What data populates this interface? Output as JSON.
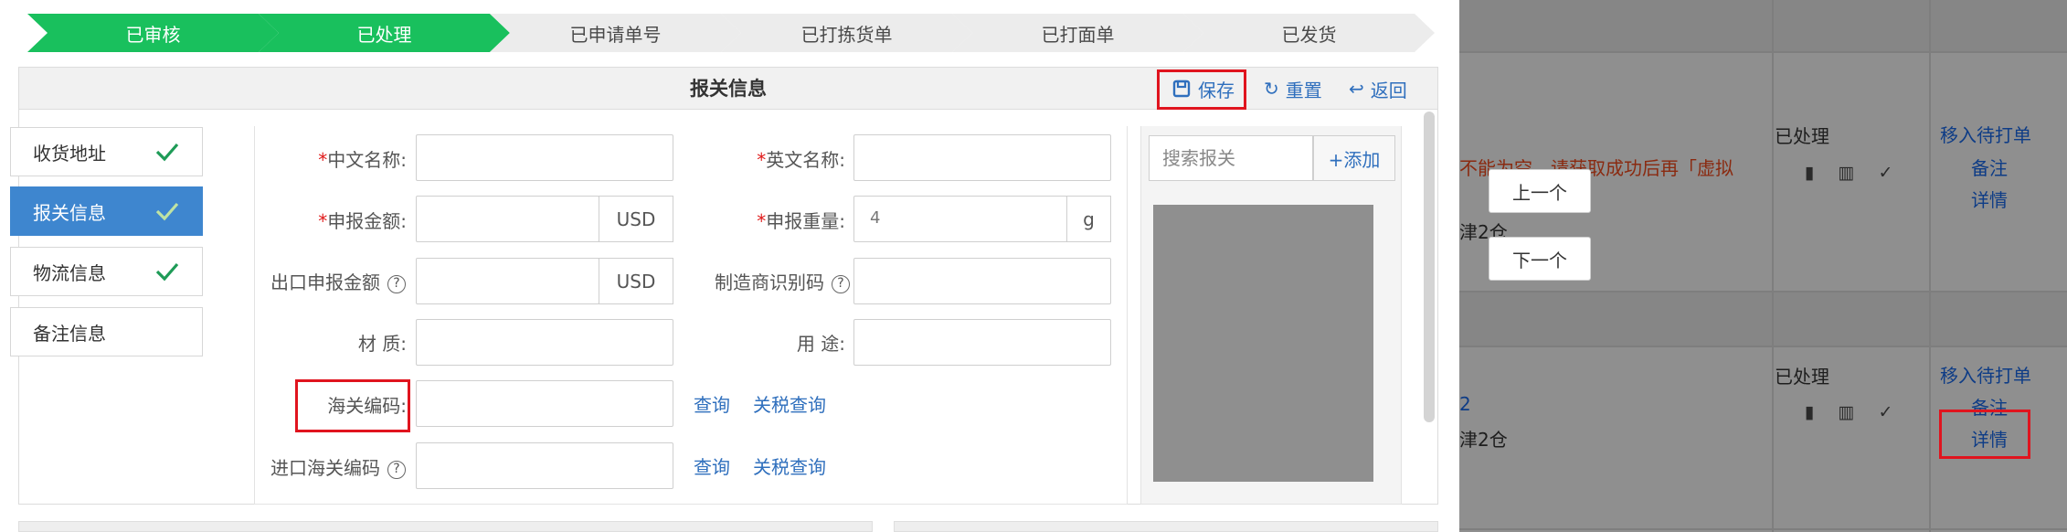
{
  "steps": [
    {
      "label": "已审核",
      "done": true
    },
    {
      "label": "已处理",
      "done": true
    },
    {
      "label": "已申请单号",
      "done": false
    },
    {
      "label": "已打拣货单",
      "done": false
    },
    {
      "label": "已打面单",
      "done": false
    },
    {
      "label": "已发货",
      "done": false
    }
  ],
  "panel": {
    "title": "报关信息",
    "save_label": "保存",
    "reset_label": "重置",
    "back_label": "返回"
  },
  "side_menu": [
    {
      "label": "收货地址",
      "checked": true,
      "active": false
    },
    {
      "label": "报关信息",
      "checked": true,
      "active": true
    },
    {
      "label": "物流信息",
      "checked": true,
      "active": false
    },
    {
      "label": "备注信息",
      "checked": false,
      "active": false
    }
  ],
  "form": {
    "cn_name_label": "中文名称",
    "en_name_label": "英文名称",
    "declare_amount_label": "申报金额",
    "declare_amount_unit": "USD",
    "declare_weight_label": "申报重量",
    "declare_weight_value": "4",
    "declare_weight_unit": "g",
    "export_amount_label": "出口申报金额",
    "export_amount_unit": "USD",
    "manufacturer_id_label": "制造商识别码",
    "material_label": "材 质",
    "usage_label": "用 途",
    "hs_code_label": "海关编码",
    "import_hs_code_label": "进口海关编码",
    "query_label": "查询",
    "tariff_query_label": "关税查询",
    "required_mark": "*",
    "colon": ":",
    "help_mark": "?"
  },
  "right_col": {
    "search_placeholder": "搜索报关",
    "add_label": "+添加"
  },
  "background": {
    "status": "已处理",
    "action_move": "移入待打单",
    "action_note": "备注",
    "action_detail": "详情",
    "warning_text": "不能为空，请获取成功后再「虚拟",
    "warehouse_text": "津2仓",
    "number_fragment": "2",
    "prev_label": "上一个",
    "next_label": "下一个"
  },
  "colors": {
    "step_done": "#19c05d",
    "step_todo": "#ececec",
    "active_menu": "#3e86cf",
    "link": "#2f6fbd",
    "highlight_box": "#e0141e"
  }
}
